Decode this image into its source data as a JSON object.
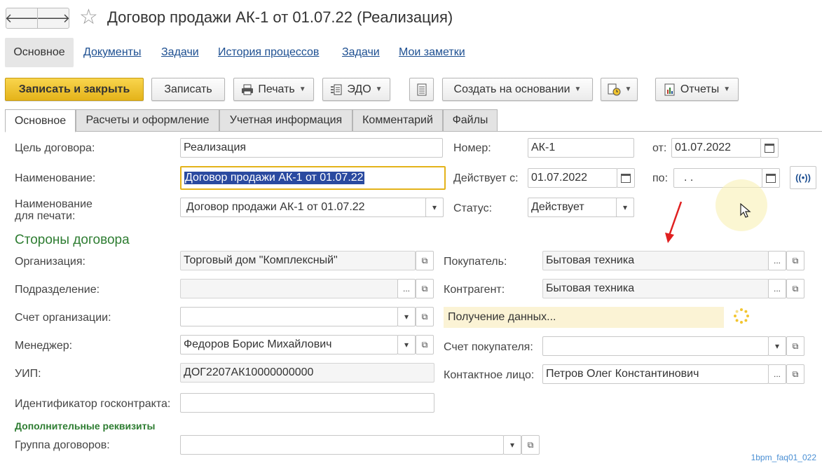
{
  "window": {
    "title": "Договор продажи АК-1 от 01.07.22 (Реализация)",
    "back_glyph": "🡐",
    "forward_glyph": "🡒"
  },
  "nav_links": [
    "Основное",
    "Документы",
    "Задачи",
    "История процессов",
    "Задачи",
    "Мои заметки"
  ],
  "toolbar": {
    "save_close": "Записать и закрыть",
    "save": "Записать",
    "print": "Печать",
    "edo": "ЭДО",
    "create_based": "Создать на основании",
    "reports": "Отчеты"
  },
  "tabs": [
    "Основное",
    "Расчеты и оформление",
    "Учетная информация",
    "Комментарий",
    "Файлы"
  ],
  "form": {
    "purpose_label": "Цель договора:",
    "purpose_value": "Реализация",
    "number_label": "Номер:",
    "number_value": "АК-1",
    "from_label": "от:",
    "from_value": "01.07.2022",
    "name_label": "Наименование:",
    "name_value": "Договор продажи АК-1 от 01.07.22",
    "valid_from_label": "Действует с:",
    "valid_from_value": "01.07.2022",
    "valid_to_label": "по:",
    "valid_to_value": ".  .",
    "print_name_label_1": "Наименование",
    "print_name_label_2": "для печати:",
    "print_name_value": "Договор продажи АК-1 от 01.07.22",
    "status_label": "Статус:",
    "status_value": "Действует"
  },
  "parties": {
    "heading": "Стороны договора",
    "org_label": "Организация:",
    "org_value": "Торговый дом \"Комплексный\"",
    "division_label": "Подразделение:",
    "division_value": "",
    "account_label": "Счет организации:",
    "account_value": "",
    "manager_label": "Менеджер:",
    "manager_value": "Федоров Борис Михайлович",
    "uip_label": "УИП:",
    "uip_value": "ДОГ2207АК10000000000",
    "gov_label": "Идентификатор госконтракта:",
    "gov_value": "",
    "buyer_label": "Покупатель:",
    "buyer_value": "Бытовая техника",
    "counterparty_label": "Контрагент:",
    "counterparty_value": "Бытовая техника",
    "loading_text": "Получение данных...",
    "buyer_account_label": "Счет покупателя:",
    "buyer_account_value": "",
    "contact_label": "Контактное лицо:",
    "contact_value": "Петров Олег Константинович"
  },
  "extra": {
    "heading": "Дополнительные реквизиты",
    "group_label": "Группа договоров:",
    "group_value": ""
  },
  "footer_tag": "1bpm_faq01_022",
  "colors": {
    "accent_yellow": "#f2c530",
    "section_green": "#2e7d32",
    "link_blue": "#1d4f91",
    "arrow_red": "#e02020"
  }
}
